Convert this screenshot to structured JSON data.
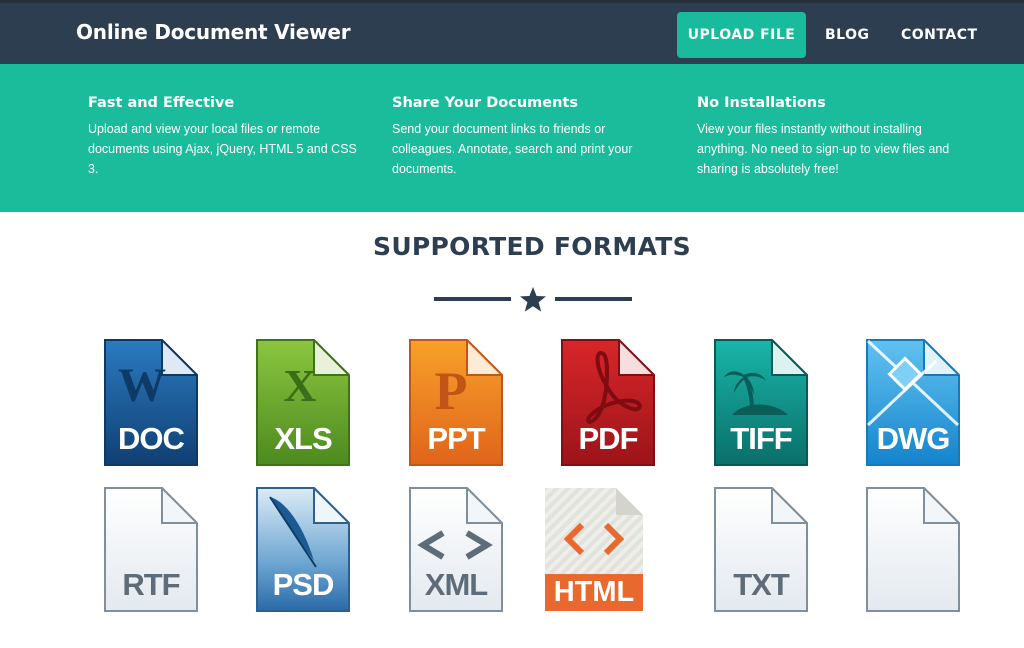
{
  "nav": {
    "brand": "Online Document Viewer",
    "upload": "UPLOAD FILE",
    "blog": "BLOG",
    "contact": "CONTACT"
  },
  "features": [
    {
      "title": "Fast and Effective",
      "text": "Upload and view your local files or remote documents using Ajax, jQuery, HTML 5 and CSS 3."
    },
    {
      "title": "Share Your Documents",
      "text": "Send your document links to friends or colleagues. Annotate, search and print your documents."
    },
    {
      "title": "No Installations",
      "text": "View your files instantly without installing anything. No need to sign-up to view files and sharing is absolutely free!"
    }
  ],
  "section": {
    "title": "SUPPORTED FORMATS"
  },
  "formats": {
    "doc": "DOC",
    "xls": "XLS",
    "ppt": "PPT",
    "pdf": "PDF",
    "tiff": "TIFF",
    "dwg": "DWG",
    "rtf": "RTF",
    "psd": "PSD",
    "xml": "XML",
    "html": "HTML",
    "txt": "TXT"
  },
  "colors": {
    "navbar": "#2c3e50",
    "accent": "#18bc9c",
    "hero": "#1abc9c"
  }
}
